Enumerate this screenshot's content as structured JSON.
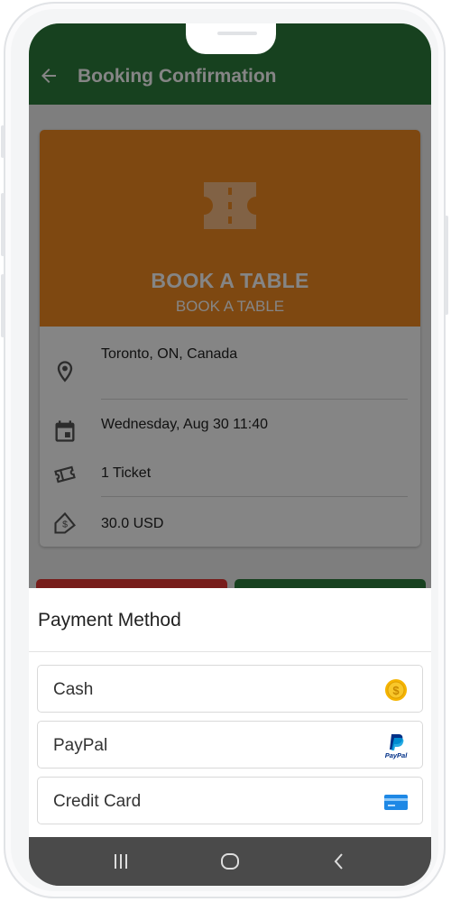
{
  "app_bar": {
    "title": "Booking Confirmation",
    "color": "#2d7d3c"
  },
  "event_card": {
    "banner_color": "#f28a22",
    "title": "BOOK A TABLE",
    "subtitle": "BOOK A TABLE",
    "details": [
      {
        "icon": "location-pin-icon",
        "text": "Toronto, ON, Canada"
      },
      {
        "icon": "calendar-icon",
        "text": "Wednesday, Aug 30 11:40"
      },
      {
        "icon": "ticket-icon",
        "text": "1 Ticket"
      },
      {
        "icon": "price-tag-icon",
        "text": "30.0 USD"
      }
    ]
  },
  "action_buttons": {
    "left_color": "#e53935",
    "right_color": "#2d7d3c"
  },
  "payment_sheet": {
    "title": "Payment Method",
    "options": [
      {
        "label": "Cash",
        "icon": "coin-icon"
      },
      {
        "label": "PayPal",
        "icon": "paypal-icon",
        "icon_text": "PayPal"
      },
      {
        "label": "Credit Card",
        "icon": "credit-card-icon"
      }
    ]
  },
  "system_nav": {
    "buttons": [
      "recent-apps-icon",
      "home-icon",
      "back-nav-icon"
    ]
  }
}
